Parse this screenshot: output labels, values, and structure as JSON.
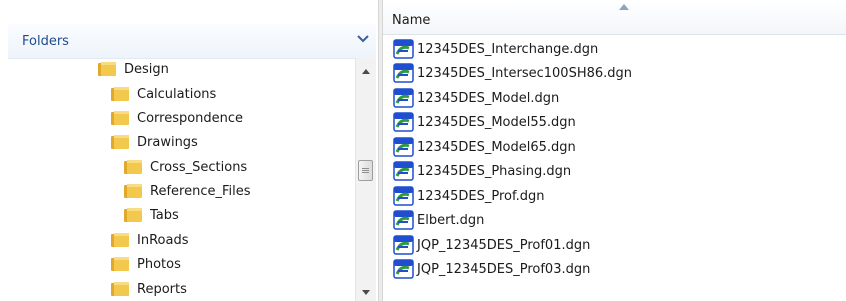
{
  "folders_pane": {
    "header_label": "Folders",
    "tree": [
      {
        "label": "Design"
      },
      {
        "label": "Calculations"
      },
      {
        "label": "Correspondence"
      },
      {
        "label": "Drawings"
      },
      {
        "label": "Cross_Sections"
      },
      {
        "label": "Reference_Files"
      },
      {
        "label": "Tabs"
      },
      {
        "label": "InRoads"
      },
      {
        "label": "Photos"
      },
      {
        "label": "Reports"
      }
    ]
  },
  "files_pane": {
    "column_header": "Name",
    "sort": "ascending",
    "files": [
      {
        "name": "12345DES_Interchange.dgn"
      },
      {
        "name": "12345DES_Intersec100SH86.dgn"
      },
      {
        "name": "12345DES_Model.dgn"
      },
      {
        "name": "12345DES_Model55.dgn"
      },
      {
        "name": "12345DES_Model65.dgn"
      },
      {
        "name": "12345DES_Phasing.dgn"
      },
      {
        "name": "12345DES_Prof.dgn"
      },
      {
        "name": "Elbert.dgn"
      },
      {
        "name": "JQP_12345DES_Prof01.dgn"
      },
      {
        "name": "JQP_12345DES_Prof03.dgn"
      }
    ]
  },
  "icons": {
    "folder": "folder-icon",
    "file": "dgn-file-icon",
    "collapse": "chevron-down-icon",
    "sort": "sort-ascending-icon",
    "scroll_up": "scroll-up-arrow-icon",
    "scroll_down": "scroll-down-arrow-icon"
  },
  "colors": {
    "folders_label": "#1e4b8e",
    "folder_icon": "#e8b83c",
    "dgn_icon_blue": "#1f4fd0",
    "dgn_icon_green": "#2e9b3c"
  }
}
